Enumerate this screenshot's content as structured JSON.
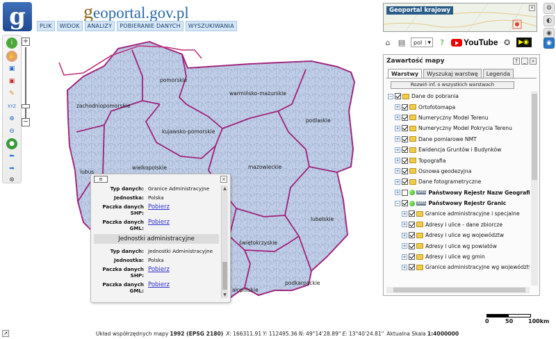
{
  "header": {
    "logo_letter": "g",
    "brand_first": "g",
    "brand_rest": "eoportal",
    "brand_suffix": ".gov.pl",
    "menu": [
      "PLIK",
      "WIDOK",
      "ANALIZY",
      "POBIERANIE DANYCH",
      "WYSZUKIWANIA"
    ]
  },
  "minimap": {
    "title": "Geoportal krajowy"
  },
  "toolbar": {
    "language": "pol",
    "youtube": "YouTube"
  },
  "map": {
    "regions": [
      {
        "key": "pomorskie",
        "label": "pomorskie"
      },
      {
        "key": "zachodniopomorskie",
        "label": "zachodniopomorskie"
      },
      {
        "key": "warminsko",
        "label": "warmińsko-mazurskie"
      },
      {
        "key": "podlaskie",
        "label": "podlaskie"
      },
      {
        "key": "kujawsko",
        "label": "kujawsko-pomorskie"
      },
      {
        "key": "lubuskie",
        "label": "lubus"
      },
      {
        "key": "wielkopolskie",
        "label": "wielkopolskie"
      },
      {
        "key": "mazowieckie",
        "label": "mazowieckie"
      },
      {
        "key": "lubelskie",
        "label": "lubelskie"
      },
      {
        "key": "swietokrzyskie",
        "label": "świętokrzyskie"
      },
      {
        "key": "malopolskie",
        "label": "ałopolskie"
      },
      {
        "key": "podkarpackie",
        "label": "podkarpackie"
      }
    ],
    "colors": {
      "fill": "#bfcde6",
      "border": "#a0207a",
      "mesh": "#8a9fc2"
    }
  },
  "popup": {
    "header_icon": "≡",
    "close": "×",
    "rows1": [
      {
        "key": "Typ danych:",
        "value": "Granice Administracyjne"
      },
      {
        "key": "Jednostka:",
        "value": "Polska"
      }
    ],
    "links1": [
      {
        "key": "Paczka danych SHP:",
        "link": "Pobierz"
      },
      {
        "key": "Paczka danych GML:",
        "link": "Pobierz"
      }
    ],
    "section": "Jednostki administracyjne",
    "rows2": [
      {
        "key": "Typ danych:",
        "value": "Jednostki Administracyjne"
      },
      {
        "key": "Jednostka:",
        "value": "Polska"
      }
    ],
    "links2": [
      {
        "key": "Paczka danych SHP:",
        "link": "Pobierz"
      },
      {
        "key": "Paczka danych GML:",
        "link": "Pobierz"
      }
    ]
  },
  "panel": {
    "title": "Zawartość mapy",
    "help": "?",
    "tabs": [
      "Warstwy",
      "Wyszukaj warstwę",
      "Legenda"
    ],
    "expand_all": "Rozwiń inf. o wszystkich warstwach",
    "tree": [
      {
        "level": 0,
        "exp": "−",
        "checked": true,
        "icon": "folder",
        "label": "Dane do pobrania",
        "bold": false
      },
      {
        "level": 1,
        "exp": "+",
        "checked": true,
        "icon": "folder",
        "label": "Ortofotomapa",
        "bold": false
      },
      {
        "level": 1,
        "exp": "+",
        "checked": true,
        "icon": "folder",
        "label": "Numeryczny Model Terenu",
        "bold": false
      },
      {
        "level": 1,
        "exp": "+",
        "checked": true,
        "icon": "folder",
        "label": "Numeryczny Model Pokrycia Terenu",
        "bold": false
      },
      {
        "level": 1,
        "exp": "+",
        "checked": true,
        "icon": "folder",
        "label": "Dane pomiarowe NMT",
        "bold": false
      },
      {
        "level": 1,
        "exp": "+",
        "checked": true,
        "icon": "folder",
        "label": "Ewidencja Gruntów i Budynków",
        "bold": false
      },
      {
        "level": 1,
        "exp": "+",
        "checked": true,
        "icon": "folder",
        "label": "Topografia",
        "bold": false
      },
      {
        "level": 1,
        "exp": "+",
        "checked": true,
        "icon": "folder",
        "label": "Osnowa geodezyjna",
        "bold": false
      },
      {
        "level": 1,
        "exp": "+",
        "checked": true,
        "icon": "folder",
        "label": "Dane fotogrametryczne",
        "bold": false
      },
      {
        "level": 1,
        "exp": "+",
        "checked": false,
        "icon": "wms",
        "label": "Państwowy Rejestr Nazw Geograficznych",
        "bold": true
      },
      {
        "level": 1,
        "exp": "−",
        "checked": true,
        "icon": "wms",
        "label": "Państwowy Rejestr Granic",
        "bold": true
      },
      {
        "level": 2,
        "exp": "+",
        "checked": true,
        "icon": "folder",
        "label": "Granice administracyjne i specjalne",
        "bold": false
      },
      {
        "level": 2,
        "exp": "+",
        "checked": true,
        "icon": "folder",
        "label": "Adresy i ulice - dane zbiorcze",
        "bold": false
      },
      {
        "level": 2,
        "exp": "+",
        "checked": true,
        "icon": "folder",
        "label": "Adresy i ulice wg województw",
        "bold": false
      },
      {
        "level": 2,
        "exp": "+",
        "checked": true,
        "icon": "folder",
        "label": "Adresy i ulice wg powiatów",
        "bold": false
      },
      {
        "level": 2,
        "exp": "+",
        "checked": true,
        "icon": "folder",
        "label": "Adresy i ulice wg gmin",
        "bold": false
      },
      {
        "level": 2,
        "exp": "+",
        "checked": true,
        "icon": "folder",
        "label": "Granice administracyjne wg województw",
        "bold": false
      }
    ]
  },
  "scalebar": {
    "t0": "0",
    "t1": "50",
    "t2": "100km"
  },
  "status": {
    "label": "Układ współrzędnych mapy",
    "system": "1992 (EPSG 2180)",
    "x_label": "X:",
    "x_val": "166311.91",
    "y_label": "Y:",
    "y_val": "112495.36",
    "n_label": "N:",
    "n_val": "49°14'28.89\"",
    "e_label": "E:",
    "e_val": "13°40'24.81\"",
    "scale_label": "Aktualna Skala",
    "scale_val": "1:4000000"
  }
}
